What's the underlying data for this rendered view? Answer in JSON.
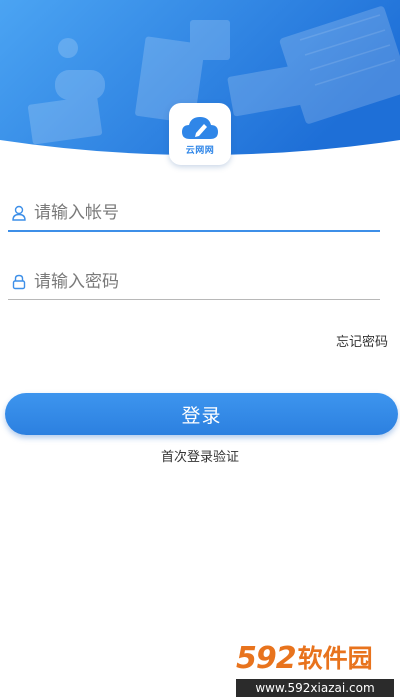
{
  "logo": {
    "text": "云网网",
    "brand_color": "#2f86e8"
  },
  "form": {
    "account_placeholder": "请输入帐号",
    "password_placeholder": "请输入密码",
    "account_icon": "user-icon",
    "password_icon": "lock-icon",
    "forgot_label": "忘记密码",
    "login_label": "登录",
    "first_verify_label": "首次登录验证"
  },
  "colors": {
    "primary": "#2f86e8",
    "hero_start": "#4aa3f2",
    "hero_end": "#1f6fd8"
  },
  "watermark": {
    "number": "592",
    "text": "软件园",
    "url": "www.592xiazai.com"
  }
}
